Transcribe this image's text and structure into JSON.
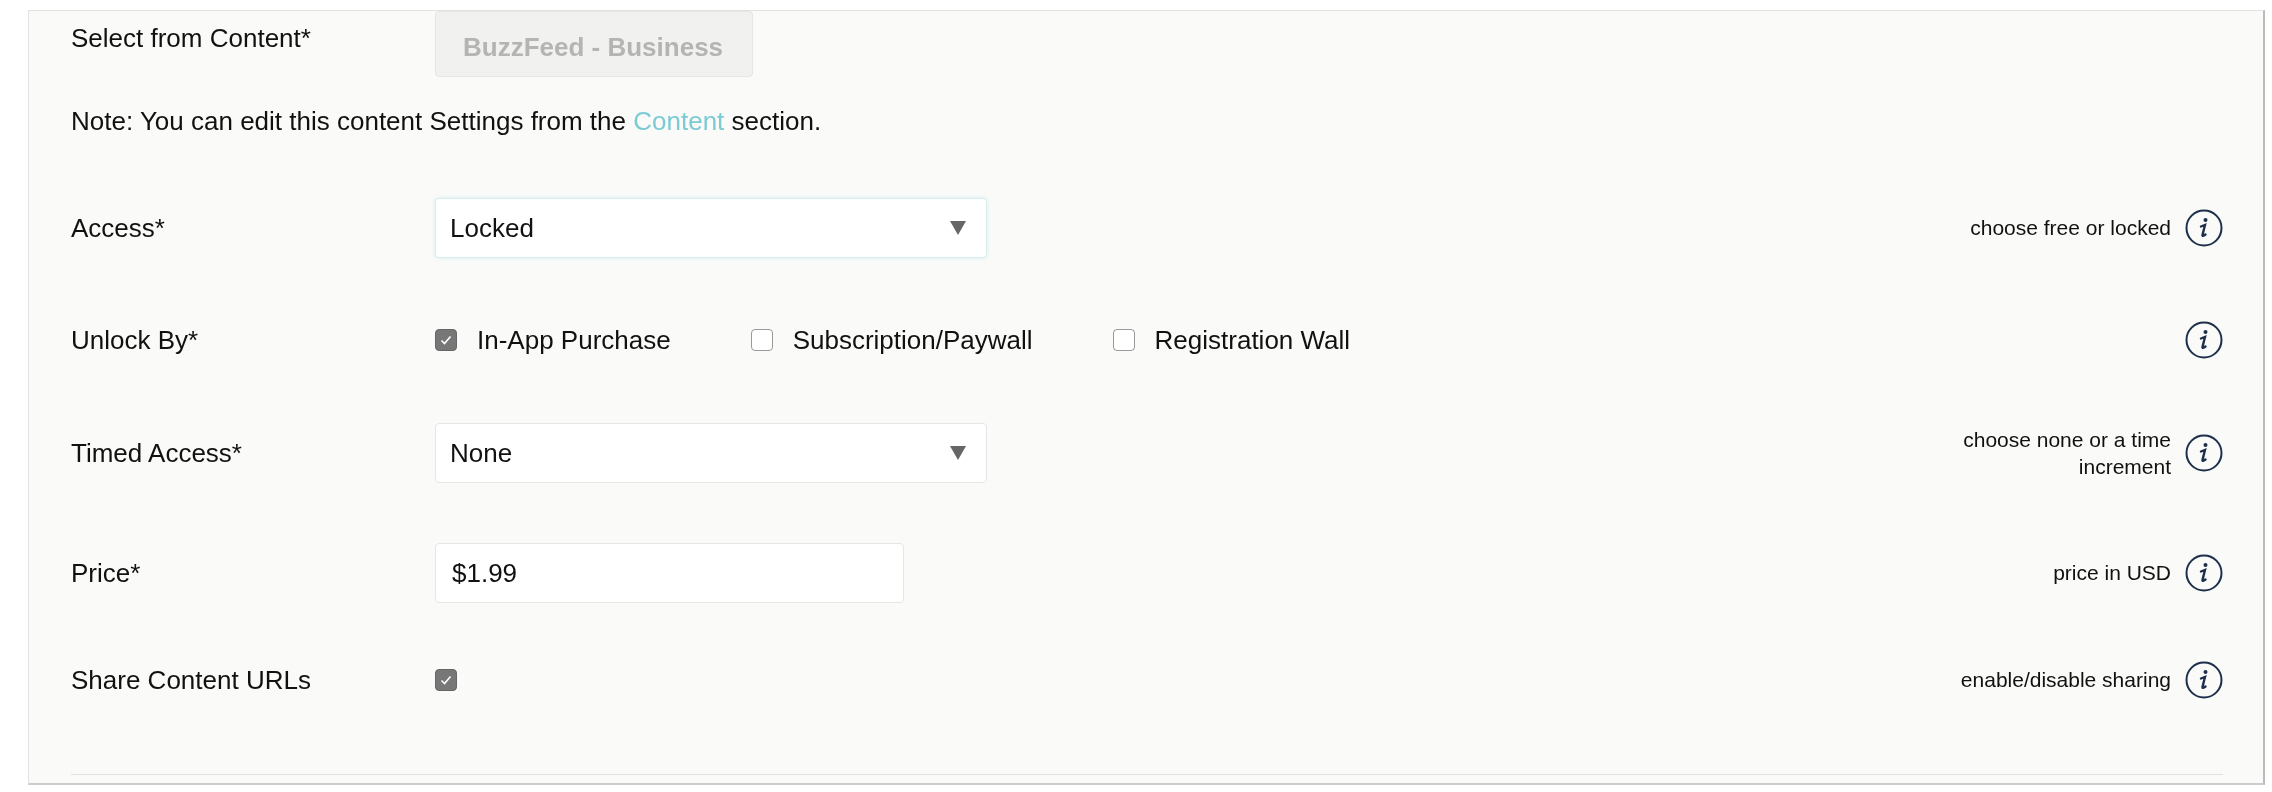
{
  "select_from_content": {
    "label": "Select from Content*",
    "value": "BuzzFeed - Business",
    "disabled": true
  },
  "note": {
    "before": "Note: You can edit this content Settings from the ",
    "link": "Content",
    "after": " section."
  },
  "fields": [
    {
      "kind": "select",
      "label": "Access*",
      "value": "Locked",
      "focused": true,
      "help": "choose free or locked"
    },
    {
      "kind": "checkboxes",
      "label": "Unlock By*",
      "options": [
        {
          "label": "In-App Purchase",
          "checked": true
        },
        {
          "label": "Subscription/Paywall",
          "checked": false
        },
        {
          "label": "Registration Wall",
          "checked": false
        }
      ]
    },
    {
      "kind": "select",
      "label": "Timed Access*",
      "value": "None",
      "focused": false,
      "help": "choose none or a time increment"
    },
    {
      "kind": "text",
      "label": "Price*",
      "value": "$1.99",
      "help": "price in USD"
    },
    {
      "kind": "checkbox",
      "label": "Share Content URLs",
      "checked": true,
      "help": "enable/disable sharing"
    }
  ]
}
